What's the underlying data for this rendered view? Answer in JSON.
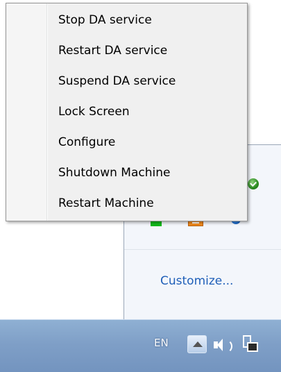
{
  "context_menu": {
    "items": [
      {
        "label": "Stop DA service"
      },
      {
        "label": "Restart DA service"
      },
      {
        "label": "Suspend DA service"
      },
      {
        "label": "Lock Screen"
      },
      {
        "label": "Configure"
      },
      {
        "label": "Shutdown Machine"
      },
      {
        "label": "Restart Machine"
      }
    ]
  },
  "tray_flyout": {
    "customize_link": "Customize...",
    "icons": [
      "green-check-icon",
      "green-monitor-icon",
      "orange-keyboard-icon",
      "shield-lock-icon"
    ]
  },
  "taskbar": {
    "language": "EN",
    "icons": [
      "show-hidden-icons-button",
      "speaker-icon",
      "network-icon"
    ]
  }
}
